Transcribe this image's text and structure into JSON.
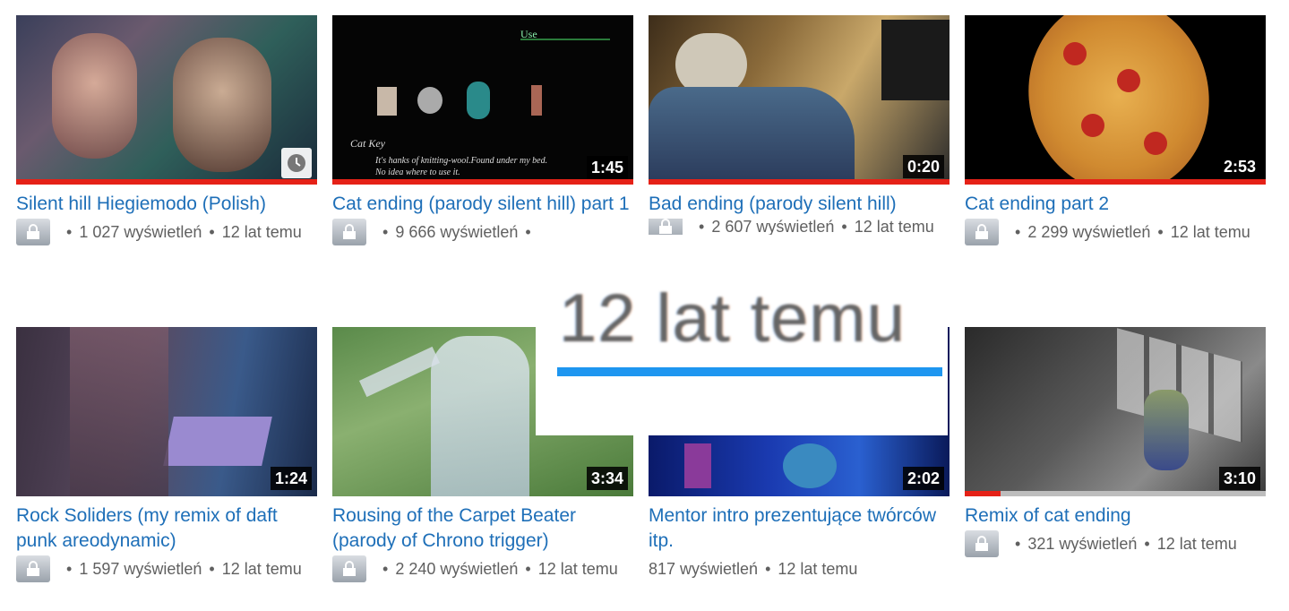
{
  "videos": [
    {
      "title": "Silent hill Hiegiemodo (Polish)",
      "duration": "",
      "views": "1 027 wyświetleń",
      "age": "12 lat temu",
      "icon": "clock-icon",
      "progress": 1.0
    },
    {
      "title": "Cat ending (parody silent hill) part 1",
      "duration": "1:45",
      "views": "9 666 wyświetleń",
      "age": "",
      "progress": 1.0,
      "overlay": {
        "use_label": "Use",
        "item_title": "Cat  Key",
        "item_desc_1": "It's hanks of knitting-wool.Found under my bed.",
        "item_desc_2": "No idea where to use it."
      }
    },
    {
      "title": "Bad ending (parody silent hill)",
      "duration": "0:20",
      "views": "2 607 wyświetleń",
      "age": "12 lat temu",
      "progress": 1.0
    },
    {
      "title": "Cat ending part 2",
      "duration": "2:53",
      "views": "2 299 wyświetleń",
      "age": "12 lat temu",
      "progress": 1.0
    },
    {
      "title": "Rock Soliders (my remix of daft punk areodynamic)",
      "duration": "1:24",
      "views": "1 597 wyświetleń",
      "age": "12 lat temu",
      "progress": 0
    },
    {
      "title": "Rousing of the Carpet Beater (parody of Chrono trigger)",
      "duration": "3:34",
      "views": "2 240 wyświetleń",
      "age": "12 lat temu",
      "progress": 0
    },
    {
      "title": "Mentor intro prezentujące twórców itp.",
      "duration": "2:02",
      "views": "817 wyświetleń",
      "age": "12 lat temu",
      "progress": 0
    },
    {
      "title": "Remix of cat ending",
      "duration": "3:10",
      "views": "321 wyświetleń",
      "age": "12 lat temu",
      "progress": 0.12
    }
  ],
  "zoom_callout": {
    "text": "12 lat temu"
  },
  "colors": {
    "title": "#1e6fb8",
    "progress": "#e52117",
    "accent_line": "#1e96f0"
  }
}
